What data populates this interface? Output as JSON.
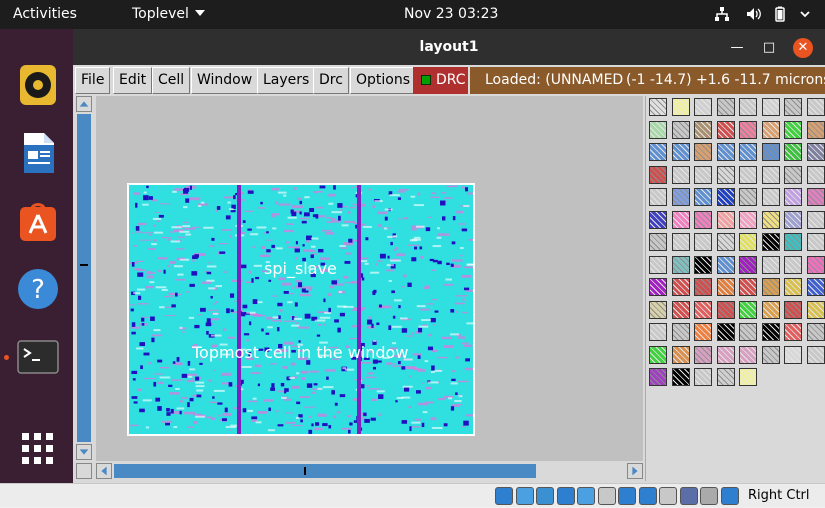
{
  "topbar": {
    "activities": "Activities",
    "app_menu": "Toplevel",
    "clock": "Nov 23  03:23",
    "tray_icons": [
      "network-icon",
      "volume-icon",
      "battery-icon",
      "power-menu-icon"
    ]
  },
  "dock": {
    "apps": [
      "rhythmbox-icon",
      "libreoffice-writer-icon",
      "ubuntu-software-icon",
      "help-icon",
      "terminal-icon",
      "show-applications-icon"
    ],
    "active_app": "terminal-icon"
  },
  "window": {
    "title": "layout1",
    "controls": [
      "minimize",
      "maximize",
      "close"
    ]
  },
  "menubar": {
    "items": [
      "File",
      "Edit",
      "Cell",
      "Window",
      "Layers",
      "Drc",
      "Options"
    ],
    "drc_label": "DRC",
    "status_loaded": "Loaded: (UNNAMED)",
    "status_coords": "(-1 -14.7) +1.6 -11.7 microns"
  },
  "canvas": {
    "cell_name": "spi_slave",
    "cell_description": "Topmost cell in the window"
  },
  "colors": {
    "topbar_bg": "#1d1d1d",
    "dock_bg": "#3a1f33",
    "accent": "#e95420",
    "drc_button": "#b03030",
    "status_bar": "#8b5a2b",
    "scroll_blue": "#4a8ac4",
    "canvas_bg": "#c0c0c0",
    "layout_cyan": "#30e0e0",
    "metal_purple": "#8020c0"
  },
  "palette": {
    "swatches": [
      "#e0e0e0",
      "#f0f0a0",
      "#d0d0d0",
      "#c8c8c8",
      "#c8c8c8",
      "#d0d0d0",
      "#c8c8c8",
      "#c8c8c8",
      "#a8d8a8",
      "#c8c8c8",
      "#a89070",
      "#d05050",
      "#f080a0",
      "#d8a070",
      "#40d040",
      "#d8a070",
      "#6090d0",
      "#6090d0",
      "#d8a070",
      "#6090d0",
      "#6090d0",
      "#6090d0",
      "#40c040",
      "#8080a0",
      "#d05050",
      "#c8c8c8",
      "#c8c8c8",
      "#d8d8d8",
      "#c8c8c8",
      "#c8c8c8",
      "#c8c8c8",
      "#c8c8c8",
      "#c8c8c8",
      "#80a0e0",
      "#6090d0",
      "#2040c0",
      "#c8c8c8",
      "#c8c8c8",
      "#c0a0e0",
      "#e080c0",
      "#4040c0",
      "#f080c0",
      "#f080c0",
      "#f0a0a0",
      "#f0a0c0",
      "#f0e080",
      "#a0a0d0",
      "#c8c8c8",
      "#c8c8c8",
      "#c8c8c8",
      "#c8c8c8",
      "#d8d8d8",
      "#e0e060",
      "#000000",
      "#40c0c0",
      "#c8c8c8",
      "#c8c8c8",
      "#80c0c0",
      "#000000",
      "#6090d0",
      "#a020c0",
      "#c8c8c8",
      "#c8c8c8",
      "#f070c0",
      "#a020c0",
      "#d05050",
      "#d05050",
      "#e08040",
      "#d05050",
      "#d8a050",
      "#d8c050",
      "#4060d0",
      "#d8d0a8",
      "#d05050",
      "#e06060",
      "#d05050",
      "#40d040",
      "#d8a050",
      "#d05050",
      "#d8c050",
      "#c8c8c8",
      "#c8c8c8",
      "#f08040",
      "#000000",
      "#c8c8c8",
      "#000000",
      "#e06060",
      "#c8c8c8",
      "#40d040",
      "#d89050",
      "#d8a0c0",
      "#d8a0c0",
      "#d8a0c0",
      "#c8c8c8",
      "#d8d8d8",
      "#c8c8c8",
      "#a040c0",
      "#000000",
      "#c8c8c8",
      "#d0d0d0",
      "#f0f0a0"
    ]
  },
  "vbox_status": {
    "icons": [
      "hdd-icon",
      "cd-icon",
      "audio-icon",
      "network-adapter-icon",
      "usb-icon",
      "shared-folder-icon",
      "display-icon",
      "screen-capture-icon",
      "recording-icon",
      "cpu-icon",
      "mouse-icon",
      "keyboard-icon"
    ],
    "host_key": "Right Ctrl"
  }
}
